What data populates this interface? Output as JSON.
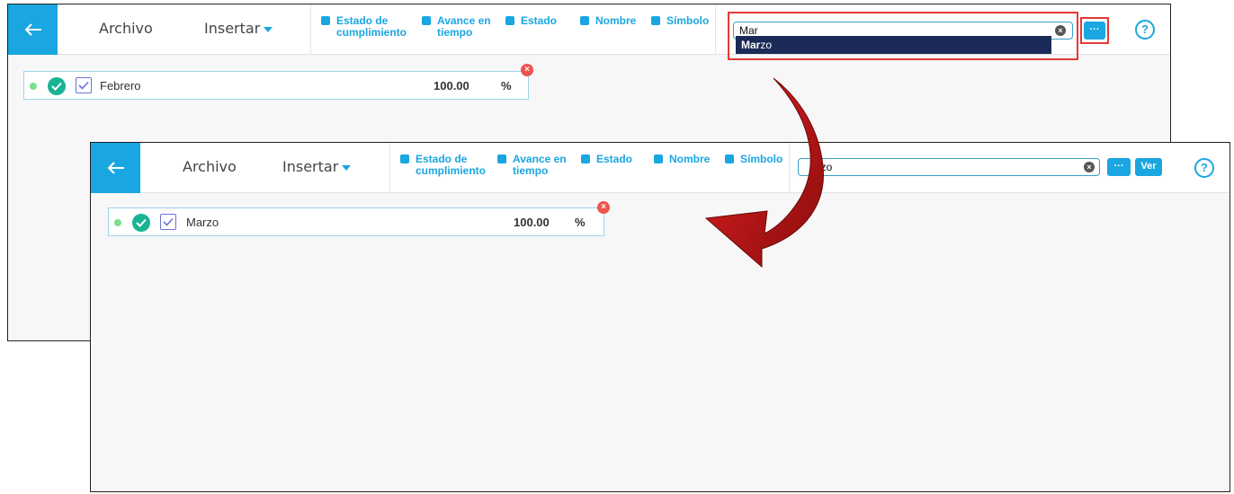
{
  "toolbar": {
    "archivo": "Archivo",
    "insertar": "Insertar",
    "columns": [
      {
        "line1": "Estado de",
        "line2": "cumplimiento"
      },
      {
        "line1": "Avance en",
        "line2": "tiempo"
      },
      {
        "line1": "Estado",
        "line2": ""
      },
      {
        "line1": "Nombre",
        "line2": ""
      },
      {
        "line1": "Símbolo",
        "line2": ""
      }
    ],
    "more_label": "···",
    "ver_label": "Ver",
    "help_label": "?"
  },
  "before": {
    "search_value": "Mar",
    "suggestion_bold": "Mar",
    "suggestion_rest": "zo",
    "row": {
      "label": "Febrero",
      "value": "100.00",
      "unit": "%"
    }
  },
  "after": {
    "search_value": "Marzo",
    "search_visible": "arzo",
    "row": {
      "label": "Marzo",
      "value": "100.00",
      "unit": "%"
    }
  },
  "colors": {
    "accent": "#1aa6e0",
    "highlight": "#e53935",
    "dropdown": "#1b2a56",
    "ok": "#19b394"
  }
}
